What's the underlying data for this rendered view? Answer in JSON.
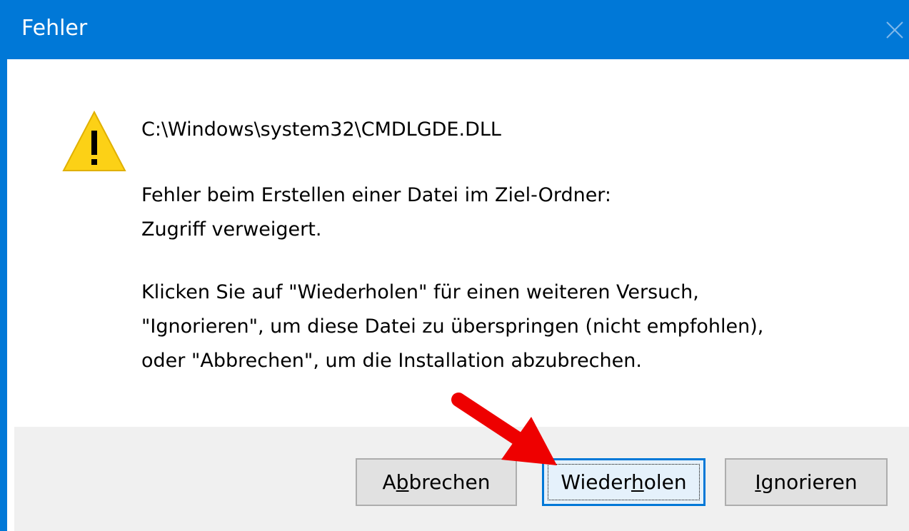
{
  "dialog": {
    "title": "Fehler"
  },
  "message": {
    "path": "C:\\Windows\\system32\\CMDLGDE.DLL",
    "error_line1": "Fehler beim Erstellen einer Datei im Ziel-Ordner:",
    "error_line2": "Zugriff verweigert.",
    "hint_line1": "Klicken Sie auf \"Wiederholen\" für einen weiteren Versuch,",
    "hint_line2": "\"Ignorieren\", um diese Datei zu überspringen (nicht empfohlen),",
    "hint_line3": "oder \"Abbrechen\", um die Installation abzubrechen."
  },
  "buttons": {
    "abort": {
      "pre": "A",
      "accel": "b",
      "post": "brechen"
    },
    "retry": {
      "pre": "Wieder",
      "accel": "h",
      "post": "olen"
    },
    "ignore": {
      "pre": "",
      "accel": "I",
      "post": "gnorieren"
    }
  },
  "icons": {
    "warning": "warning-icon",
    "close": "close-icon",
    "annotation": "red-arrow-annotation"
  },
  "colors": {
    "titlebar": "#0078d7",
    "footer": "#f0f0f0",
    "warning_fill": "#fcd116",
    "arrow": "#ee0000"
  }
}
